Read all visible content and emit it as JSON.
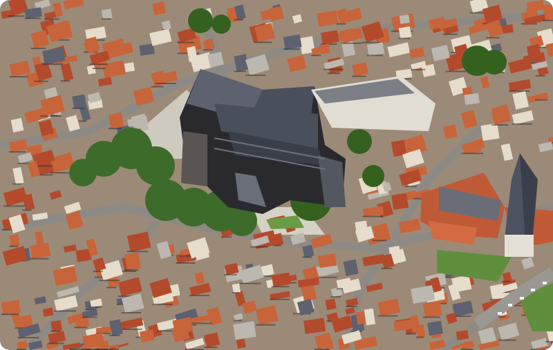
{
  "scene": {
    "kind": "aerial-photograph",
    "subject_icon": "cathedral-icon",
    "colors": {
      "roof_orange": "#c8643a",
      "roof_red": "#b34a2c",
      "roof_slate": "#5d6170",
      "cathedral_slate": "#4a4f5c",
      "facade_cream": "#e6dccb",
      "facade_grey": "#bcb8b0",
      "tree_green": "#3d6b2a",
      "lawn_green": "#5f8f3c",
      "plaza_paving": "#cfcac0",
      "street_grey": "#8d8a85",
      "shadow": "#2a2a2e"
    }
  }
}
